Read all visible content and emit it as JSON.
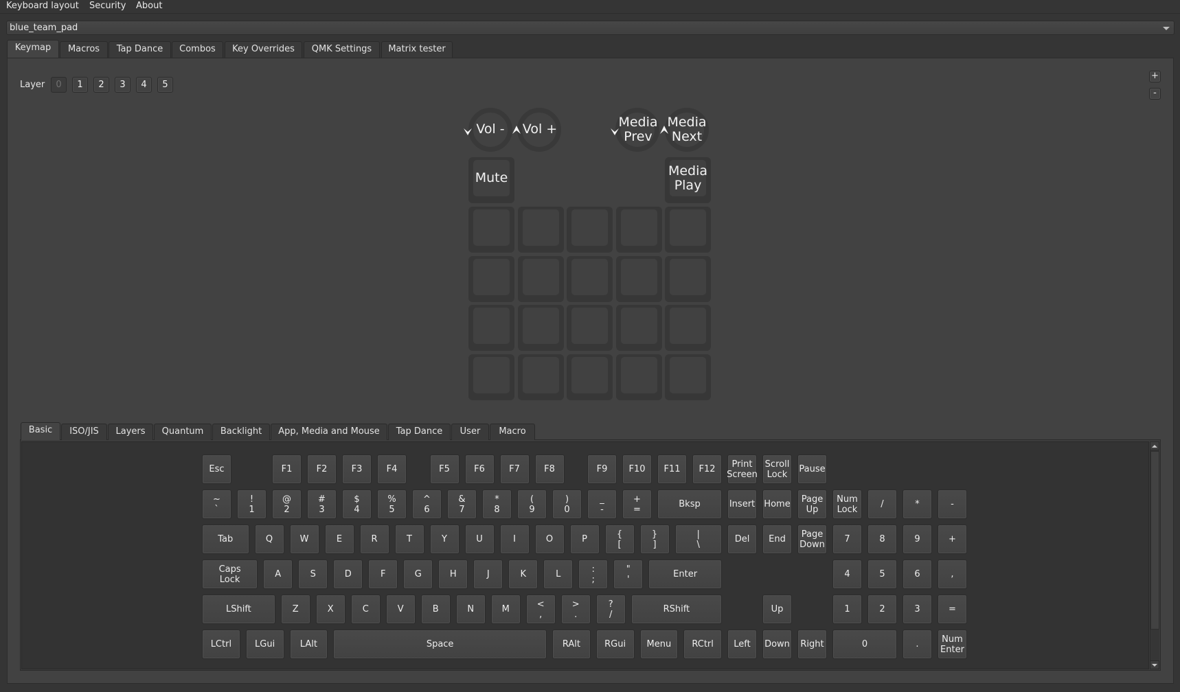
{
  "menu": [
    "Keyboard layout",
    "Security",
    "About"
  ],
  "keyboard_selector": {
    "value": "blue_team_pad"
  },
  "main_tabs": [
    {
      "label": "Keymap",
      "active": true
    },
    {
      "label": "Macros"
    },
    {
      "label": "Tap Dance"
    },
    {
      "label": "Combos"
    },
    {
      "label": "Key Overrides"
    },
    {
      "label": "QMK Settings"
    },
    {
      "label": "Matrix tester"
    }
  ],
  "layers": {
    "label": "Layer",
    "buttons": [
      "0",
      "1",
      "2",
      "3",
      "4",
      "5"
    ],
    "active": "0"
  },
  "zoom": {
    "plus": "+",
    "minus": "-"
  },
  "pad": {
    "knobs": [
      {
        "ccw": "down-arrow",
        "label": "Vol -"
      },
      {
        "cw": "up-arrow",
        "label": "Vol +"
      },
      {
        "ccw": "down-arrow",
        "label": "Media\nPrev"
      },
      {
        "cw": "up-arrow",
        "label": "Media\nNext"
      }
    ],
    "keys_top": [
      {
        "label": "Mute"
      },
      {
        "label": "Media\nPlay"
      }
    ],
    "grid_rows": 4,
    "grid_cols": 5,
    "grid_labels": [
      "",
      "",
      "",
      "",
      "",
      "",
      "",
      "",
      "",
      "",
      "",
      "",
      "",
      "",
      "",
      "",
      "",
      "",
      "",
      ""
    ]
  },
  "key_category_tabs": [
    {
      "label": "Basic",
      "active": true
    },
    {
      "label": "ISO/JIS"
    },
    {
      "label": "Layers"
    },
    {
      "label": "Quantum"
    },
    {
      "label": "Backlight"
    },
    {
      "label": "App, Media and Mouse"
    },
    {
      "label": "Tap Dance"
    },
    {
      "label": "User"
    },
    {
      "label": "Macro"
    }
  ],
  "basic_keys": [
    [
      {
        "l": "Esc",
        "x": 0
      },
      {
        "l": "F1",
        "x": 2
      },
      {
        "l": "F2",
        "x": 3
      },
      {
        "l": "F3",
        "x": 4
      },
      {
        "l": "F4",
        "x": 5
      },
      {
        "l": "F5",
        "x": 6.5
      },
      {
        "l": "F6",
        "x": 7.5
      },
      {
        "l": "F7",
        "x": 8.5
      },
      {
        "l": "F8",
        "x": 9.5
      },
      {
        "l": "F9",
        "x": 11
      },
      {
        "l": "F10",
        "x": 12
      },
      {
        "l": "F11",
        "x": 13
      },
      {
        "l": "F12",
        "x": 14
      },
      {
        "l": "Print\nScreen",
        "x": 15
      },
      {
        "l": "Scroll\nLock",
        "x": 16
      },
      {
        "l": "Pause",
        "x": 17
      }
    ],
    [
      {
        "l": "~\n`",
        "x": 0
      },
      {
        "l": "!\n1",
        "x": 1
      },
      {
        "l": "@\n2",
        "x": 2
      },
      {
        "l": "#\n3",
        "x": 3
      },
      {
        "l": "$\n4",
        "x": 4
      },
      {
        "l": "%\n5",
        "x": 5
      },
      {
        "l": "^\n6",
        "x": 6
      },
      {
        "l": "&\n7",
        "x": 7
      },
      {
        "l": "*\n8",
        "x": 8
      },
      {
        "l": "(\n9",
        "x": 9
      },
      {
        "l": ")\n0",
        "x": 10
      },
      {
        "l": "_\n-",
        "x": 11
      },
      {
        "l": "+\n=",
        "x": 12
      },
      {
        "l": "Bksp",
        "x": 13,
        "w": 2
      },
      {
        "l": "Insert",
        "x": 15
      },
      {
        "l": "Home",
        "x": 16
      },
      {
        "l": "Page\nUp",
        "x": 17
      },
      {
        "l": "Num\nLock",
        "x": 18
      },
      {
        "l": "/",
        "x": 19
      },
      {
        "l": "*",
        "x": 20
      },
      {
        "l": "-",
        "x": 21
      }
    ],
    [
      {
        "l": "Tab",
        "x": 0,
        "w": 1.5
      },
      {
        "l": "Q",
        "x": 1.5
      },
      {
        "l": "W",
        "x": 2.5
      },
      {
        "l": "E",
        "x": 3.5
      },
      {
        "l": "R",
        "x": 4.5
      },
      {
        "l": "T",
        "x": 5.5
      },
      {
        "l": "Y",
        "x": 6.5
      },
      {
        "l": "U",
        "x": 7.5
      },
      {
        "l": "I",
        "x": 8.5
      },
      {
        "l": "O",
        "x": 9.5
      },
      {
        "l": "P",
        "x": 10.5
      },
      {
        "l": "{\n[",
        "x": 11.5
      },
      {
        "l": "}\n]",
        "x": 12.5
      },
      {
        "l": "|\n\\",
        "x": 13.5,
        "w": 1.5
      },
      {
        "l": "Del",
        "x": 15
      },
      {
        "l": "End",
        "x": 16
      },
      {
        "l": "Page\nDown",
        "x": 17
      },
      {
        "l": "7",
        "x": 18
      },
      {
        "l": "8",
        "x": 19
      },
      {
        "l": "9",
        "x": 20
      },
      {
        "l": "+",
        "x": 21
      }
    ],
    [
      {
        "l": "Caps\nLock",
        "x": 0,
        "w": 1.75
      },
      {
        "l": "A",
        "x": 1.75
      },
      {
        "l": "S",
        "x": 2.75
      },
      {
        "l": "D",
        "x": 3.75
      },
      {
        "l": "F",
        "x": 4.75
      },
      {
        "l": "G",
        "x": 5.75
      },
      {
        "l": "H",
        "x": 6.75
      },
      {
        "l": "J",
        "x": 7.75
      },
      {
        "l": "K",
        "x": 8.75
      },
      {
        "l": "L",
        "x": 9.75
      },
      {
        "l": ":\n;",
        "x": 10.75
      },
      {
        "l": "\"\n'",
        "x": 11.75
      },
      {
        "l": "Enter",
        "x": 12.75,
        "w": 2.25
      },
      {
        "l": "4",
        "x": 18
      },
      {
        "l": "5",
        "x": 19
      },
      {
        "l": "6",
        "x": 20
      },
      {
        "l": ",",
        "x": 21
      }
    ],
    [
      {
        "l": "LShift",
        "x": 0,
        "w": 2.25
      },
      {
        "l": "Z",
        "x": 2.25
      },
      {
        "l": "X",
        "x": 3.25
      },
      {
        "l": "C",
        "x": 4.25
      },
      {
        "l": "V",
        "x": 5.25
      },
      {
        "l": "B",
        "x": 6.25
      },
      {
        "l": "N",
        "x": 7.25
      },
      {
        "l": "M",
        "x": 8.25
      },
      {
        "l": "<\n,",
        "x": 9.25
      },
      {
        "l": ">\n.",
        "x": 10.25
      },
      {
        "l": "?\n/",
        "x": 11.25
      },
      {
        "l": "RShift",
        "x": 12.25,
        "w": 2.75
      },
      {
        "l": "Up",
        "x": 16
      },
      {
        "l": "1",
        "x": 18
      },
      {
        "l": "2",
        "x": 19
      },
      {
        "l": "3",
        "x": 20
      },
      {
        "l": "=",
        "x": 21
      }
    ],
    [
      {
        "l": "LCtrl",
        "x": 0,
        "w": 1.25
      },
      {
        "l": "LGui",
        "x": 1.25,
        "w": 1.25
      },
      {
        "l": "LAlt",
        "x": 2.5,
        "w": 1.25
      },
      {
        "l": "Space",
        "x": 3.75,
        "w": 6.25
      },
      {
        "l": "RAlt",
        "x": 10,
        "w": 1.25
      },
      {
        "l": "RGui",
        "x": 11.25,
        "w": 1.25
      },
      {
        "l": "Menu",
        "x": 12.5,
        "w": 1.25
      },
      {
        "l": "RCtrl",
        "x": 13.75,
        "w": 1.25
      },
      {
        "l": "Left",
        "x": 15
      },
      {
        "l": "Down",
        "x": 16
      },
      {
        "l": "Right",
        "x": 17
      },
      {
        "l": "0",
        "x": 18,
        "w": 2
      },
      {
        "l": ".",
        "x": 20
      },
      {
        "l": "Num\nEnter",
        "x": 21
      }
    ]
  ]
}
